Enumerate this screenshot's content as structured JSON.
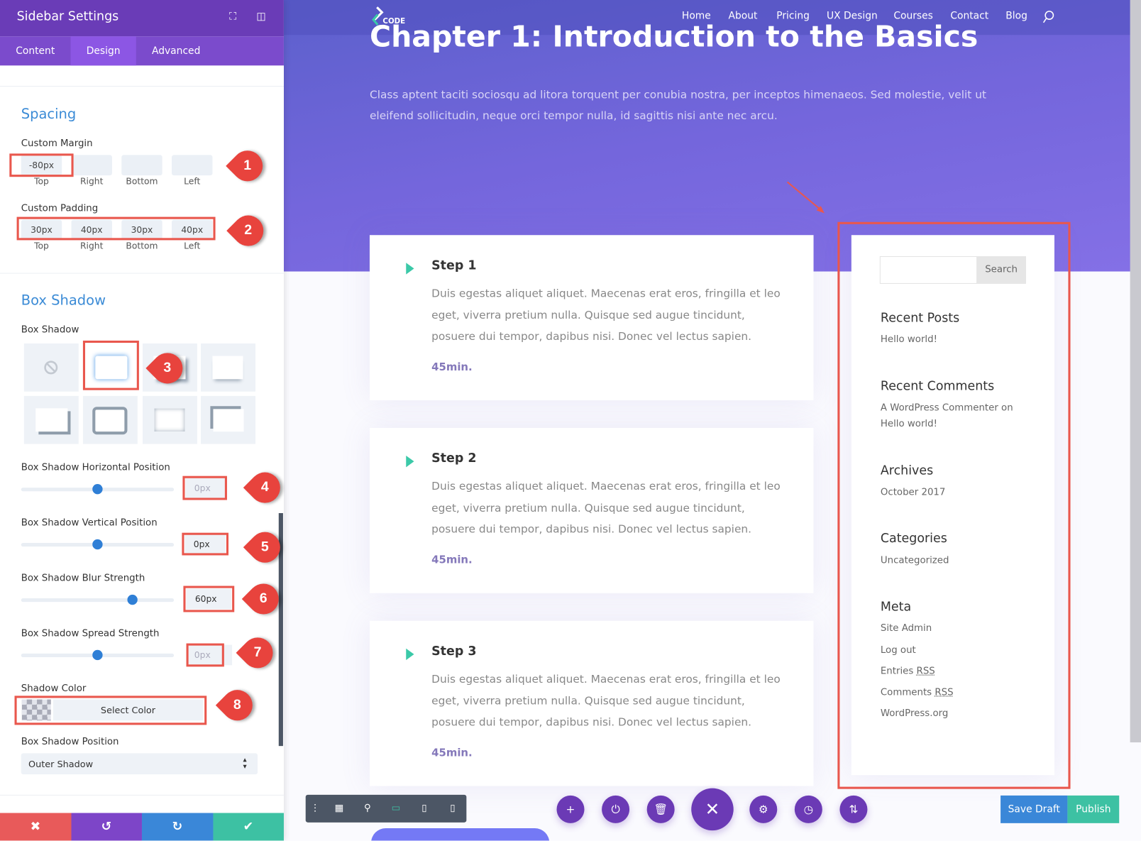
{
  "panel": {
    "title": "Sidebar Settings",
    "tabs": [
      "Content",
      "Design",
      "Advanced"
    ],
    "active_tab": "Design",
    "spacing": {
      "heading": "Spacing",
      "margin_label": "Custom Margin",
      "margin": [
        {
          "side": "Top",
          "value": "-80px"
        },
        {
          "side": "Right",
          "value": ""
        },
        {
          "side": "Bottom",
          "value": ""
        },
        {
          "side": "Left",
          "value": ""
        }
      ],
      "padding_label": "Custom Padding",
      "padding": [
        {
          "side": "Top",
          "value": "30px"
        },
        {
          "side": "Right",
          "value": "40px"
        },
        {
          "side": "Bottom",
          "value": "30px"
        },
        {
          "side": "Left",
          "value": "40px"
        }
      ]
    },
    "box_shadow": {
      "heading": "Box Shadow",
      "label": "Box Shadow",
      "selected_preset": 2,
      "sliders": [
        {
          "label": "Box Shadow Horizontal Position",
          "value": "0px",
          "fraction": 0.5
        },
        {
          "label": "Box Shadow Vertical Position",
          "value": "0px",
          "fraction": 0.5
        },
        {
          "label": "Box Shadow Blur Strength",
          "value": "60px",
          "fraction": 0.73
        },
        {
          "label": "Box Shadow Spread Strength",
          "value": "0px",
          "fraction": 0.5
        }
      ],
      "color_label": "Shadow Color",
      "color_button": "Select Color",
      "position_label": "Box Shadow Position",
      "position_value": "Outer Shadow"
    },
    "markers": [
      "1",
      "2",
      "3",
      "4",
      "5",
      "6",
      "7",
      "8"
    ],
    "footer": {
      "cancel": "✖",
      "undo": "↺",
      "redo": "↻",
      "save": "✔"
    },
    "colors": {
      "header": "#6a3cb7",
      "accent": "#3b8bd6",
      "annotation": "#e9574d"
    }
  },
  "site": {
    "logo": "CODE",
    "nav": [
      "Home",
      "About",
      "Pricing",
      "UX Design",
      "Courses",
      "Contact",
      "Blog"
    ],
    "title": "Chapter 1: Introduction to the Basics",
    "intro": "Class aptent taciti sociosqu ad litora torquent per conubia nostra, per inceptos himenaeos. Sed molestie, velit ut eleifend sollicitudin, neque orci tempor nulla, id sagittis nisi ante nec arcu.",
    "steps": [
      {
        "title": "Step 1",
        "body": "Duis egestas aliquet aliquet. Maecenas erat eros, fringilla et leo eget, viverra pretium nulla. Quisque sed augue tincidunt, posuere dui tempor, dapibus nisi. Donec vel lectus sapien.",
        "time": "45min."
      },
      {
        "title": "Step 2",
        "body": "Duis egestas aliquet aliquet. Maecenas erat eros, fringilla et leo eget, viverra pretium nulla. Quisque sed augue tincidunt, posuere dui tempor, dapibus nisi. Donec vel lectus sapien.",
        "time": "45min."
      },
      {
        "title": "Step 3",
        "body": "Duis egestas aliquet aliquet. Maecenas erat eros, fringilla et leo eget, viverra pretium nulla. Quisque sed augue tincidunt, posuere dui tempor, dapibus nisi. Donec vel lectus sapien.",
        "time": "45min."
      }
    ],
    "sidebar": {
      "search_button": "Search",
      "search_placeholder": "",
      "recent_posts": {
        "title": "Recent Posts",
        "items": [
          "Hello world!"
        ]
      },
      "recent_comments": {
        "title": "Recent Comments",
        "line1": "A WordPress Commenter on",
        "line2": "Hello world!"
      },
      "archives": {
        "title": "Archives",
        "items": [
          "October 2017"
        ]
      },
      "categories": {
        "title": "Categories",
        "items": [
          "Uncategorized"
        ]
      },
      "meta": {
        "title": "Meta",
        "site_admin": "Site Admin",
        "log_out": "Log out",
        "entries": "Entries",
        "comments": "Comments",
        "rss": "RSS",
        "wordpress": "WordPress.org"
      }
    }
  },
  "builder": {
    "save_draft": "Save Draft",
    "publish": "Publish",
    "colors": {
      "circle": "#6b3ab5",
      "save_draft": "#3a87d8",
      "publish": "#3dc1a3"
    }
  }
}
